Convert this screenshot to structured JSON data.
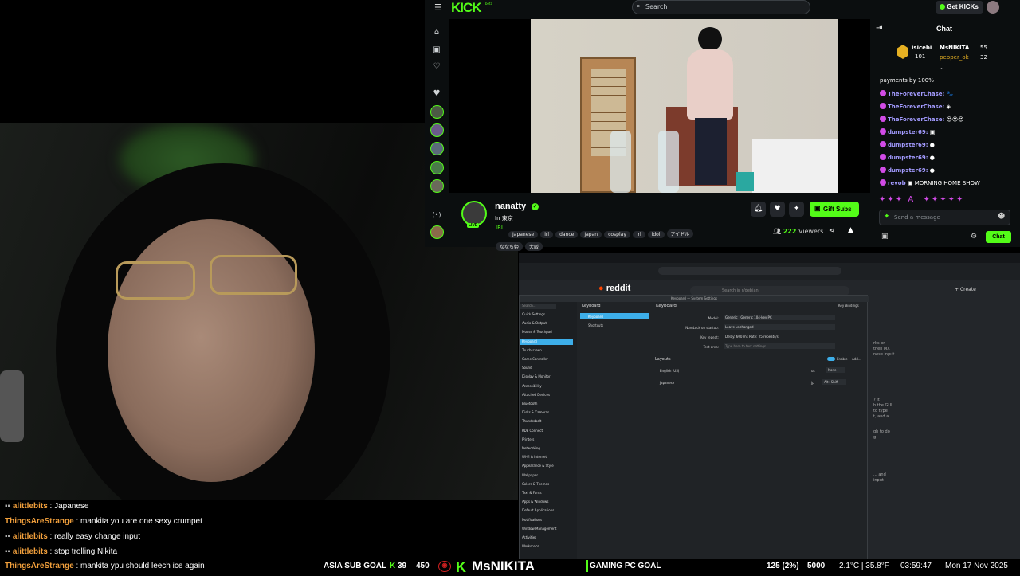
{
  "kick": {
    "logo": "KICK",
    "beta": "beta",
    "search_placeholder": "Search",
    "get_kicks": "Get KICKs",
    "streamer": {
      "name": "nanatty",
      "location_prefix": "In",
      "location": "東京",
      "category": "IRL",
      "tags": [
        "Japanese",
        "irl",
        "dance",
        "Japan",
        "cosplay",
        "irl",
        "idol",
        "アイドル",
        "ななち姫",
        "大阪"
      ],
      "viewers": "222",
      "viewers_label": "Viewers",
      "gift_subs": "Gift Subs",
      "live_badge": "LIVE"
    },
    "chat": {
      "title": "Chat",
      "leaders": [
        {
          "name": "isicebi",
          "value": "101"
        },
        {
          "name": "MsNIKITA",
          "value": "55"
        },
        {
          "name": "pepper_ok",
          "value": "32"
        }
      ],
      "notice": "payments by 100%",
      "messages": [
        {
          "user": "TheForeverChase:",
          "text": ""
        },
        {
          "user": "TheForeverChase:",
          "text": ""
        },
        {
          "user": "TheForeverChase:",
          "text": "😍😍😍"
        },
        {
          "user": "dumpster69:",
          "text": ""
        },
        {
          "user": "dumpster69:",
          "text": ""
        },
        {
          "user": "dumpster69:",
          "text": ""
        },
        {
          "user": "dumpster69:",
          "text": ""
        },
        {
          "user": "revob",
          "text": "MORNING HOME SHOW"
        }
      ],
      "input_placeholder": "Send a message",
      "send_label": "Chat"
    }
  },
  "desktop": {
    "window_title": "Keyboard — System Settings",
    "sidebar_search": "Search...",
    "sidebar_items": [
      "Quick Settings",
      "Audio & Output",
      "Mouse & Touchpad",
      "Keyboard",
      "Touchscreen",
      "Game Controller",
      "Sound",
      "Display & Monitor",
      "Accessibility",
      "Attached Devices",
      "Bluetooth",
      "Disks & Cameras",
      "Thunderbolt",
      "KDE Connect",
      "Printers",
      "Networking",
      "Wi-Fi & Internet",
      "Appearance & Style",
      "Wallpaper",
      "Colors & Themes",
      "Text & Fonts",
      "Apps & Windows",
      "Default Applications",
      "Notifications",
      "Window Management",
      "Activities",
      "Workspace"
    ],
    "middle_header": "Keyboard",
    "middle_items": [
      "Keyboard",
      "Shortcuts"
    ],
    "main_header": "Keyboard",
    "key_bindings": "Key Bindings",
    "form": [
      {
        "label": "Model:",
        "value": "Generic | Generic 104-key PC"
      },
      {
        "label": "NumLock on startup:",
        "value": "Leave unchanged"
      },
      {
        "label": "Key repeat:",
        "value": "Delay: 600 ms   Rate: 25 repeats/s"
      },
      {
        "label": "Test area:",
        "value": "Type here to test settings"
      }
    ],
    "layouts_header": "Layouts",
    "enable": "Enable",
    "add": "Add...",
    "layouts": [
      {
        "name": "English (US)",
        "code": "us",
        "action": "None"
      },
      {
        "name": "Japanese",
        "code": "jp",
        "action": "Alt+Shift"
      }
    ],
    "reddit_brand": "reddit",
    "reddit_search": "Search in r/debian",
    "reddit_create": "Create",
    "side_text": [
      "rks on",
      "then MX",
      "nese input",
      "? It",
      "h the GUI",
      "to type",
      "t, and a",
      "gh to do",
      "g",
      "... and",
      "input"
    ]
  },
  "bottom_chat": [
    {
      "name": "alittlebits",
      "sep": " : ",
      "msg": "Japanese",
      "badge": true
    },
    {
      "name": "ThingsAreStrange",
      "sep": " : ",
      "msg": "mankita you are one sexy crumpet",
      "badge": false
    },
    {
      "name": "alittlebits",
      "sep": " : ",
      "msg": "really easy change input",
      "badge": true
    },
    {
      "name": "alittlebits",
      "sep": " : ",
      "msg": "stop trolling Nikita",
      "badge": true
    }
  ],
  "ticker": {
    "last_line_name": "ThingsAreStrange",
    "last_line_msg": ": mankita ypu should leech ice again",
    "sub_goal_label": "ASIA SUB GOAL",
    "sub_goal_current": "39",
    "sub_goal_target": "450",
    "brand": "MsNIKITA",
    "pc_goal_label": "GAMING PC GOAL",
    "pc_goal_progress": "125 (2%)",
    "pc_goal_target": "5000",
    "weather": "2.1°C | 35.8°F",
    "clock": "03:59:47",
    "date": "Mon 17 Nov 2025"
  },
  "colors": {
    "kick_green": "#53fc18",
    "chat_name": "#f2a03c",
    "link_blue": "#3daee9"
  }
}
